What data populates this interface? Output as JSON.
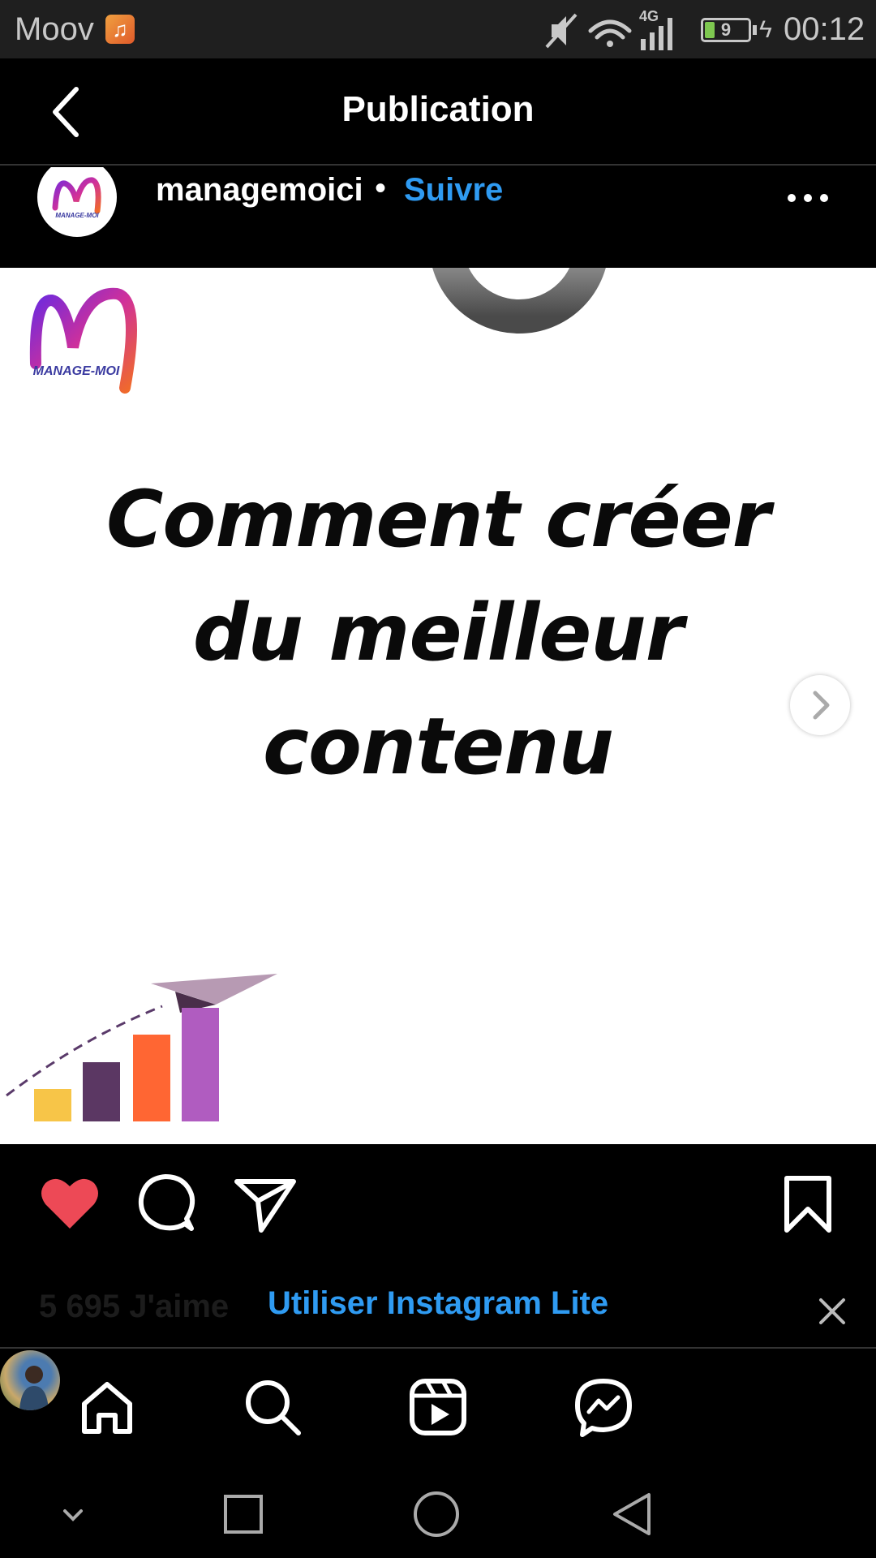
{
  "status_bar": {
    "carrier": "Moov",
    "network_type": "4G",
    "battery_level": "9",
    "time": "00:12",
    "icons": [
      "music-app-icon",
      "muted-icon",
      "wifi-icon",
      "signal-icon",
      "battery-icon",
      "charging-icon"
    ]
  },
  "header": {
    "title": "Publication",
    "back_icon": "chevron-left-icon"
  },
  "post": {
    "username": "managemoici",
    "separator": "•",
    "follow_label": "Suivre",
    "more_icon": "more-horizontal-icon",
    "logo_text": "MANAGE-MOI",
    "image": {
      "headline_lines": [
        "Comment créer",
        "du meilleur",
        "contenu"
      ]
    },
    "next_icon": "chevron-right-icon"
  },
  "actions": {
    "like_icon": "heart-filled-icon",
    "comment_icon": "comment-icon",
    "share_icon": "paper-plane-icon",
    "save_icon": "bookmark-icon",
    "like_color": "#ed4956"
  },
  "likes_row": {
    "likes_text": "5 695 J'aime",
    "promo_text": "Utiliser Instagram Lite",
    "close_icon": "close-icon"
  },
  "bottom_nav": {
    "items": [
      "home-icon",
      "search-icon",
      "reels-icon",
      "messenger-icon",
      "profile-avatar"
    ]
  },
  "system_nav": {
    "items": [
      "collapse-icon",
      "recents-icon",
      "home-circle-icon",
      "back-triangle-icon"
    ]
  },
  "colors": {
    "link_blue": "#2f9bf2",
    "background": "#000000"
  }
}
